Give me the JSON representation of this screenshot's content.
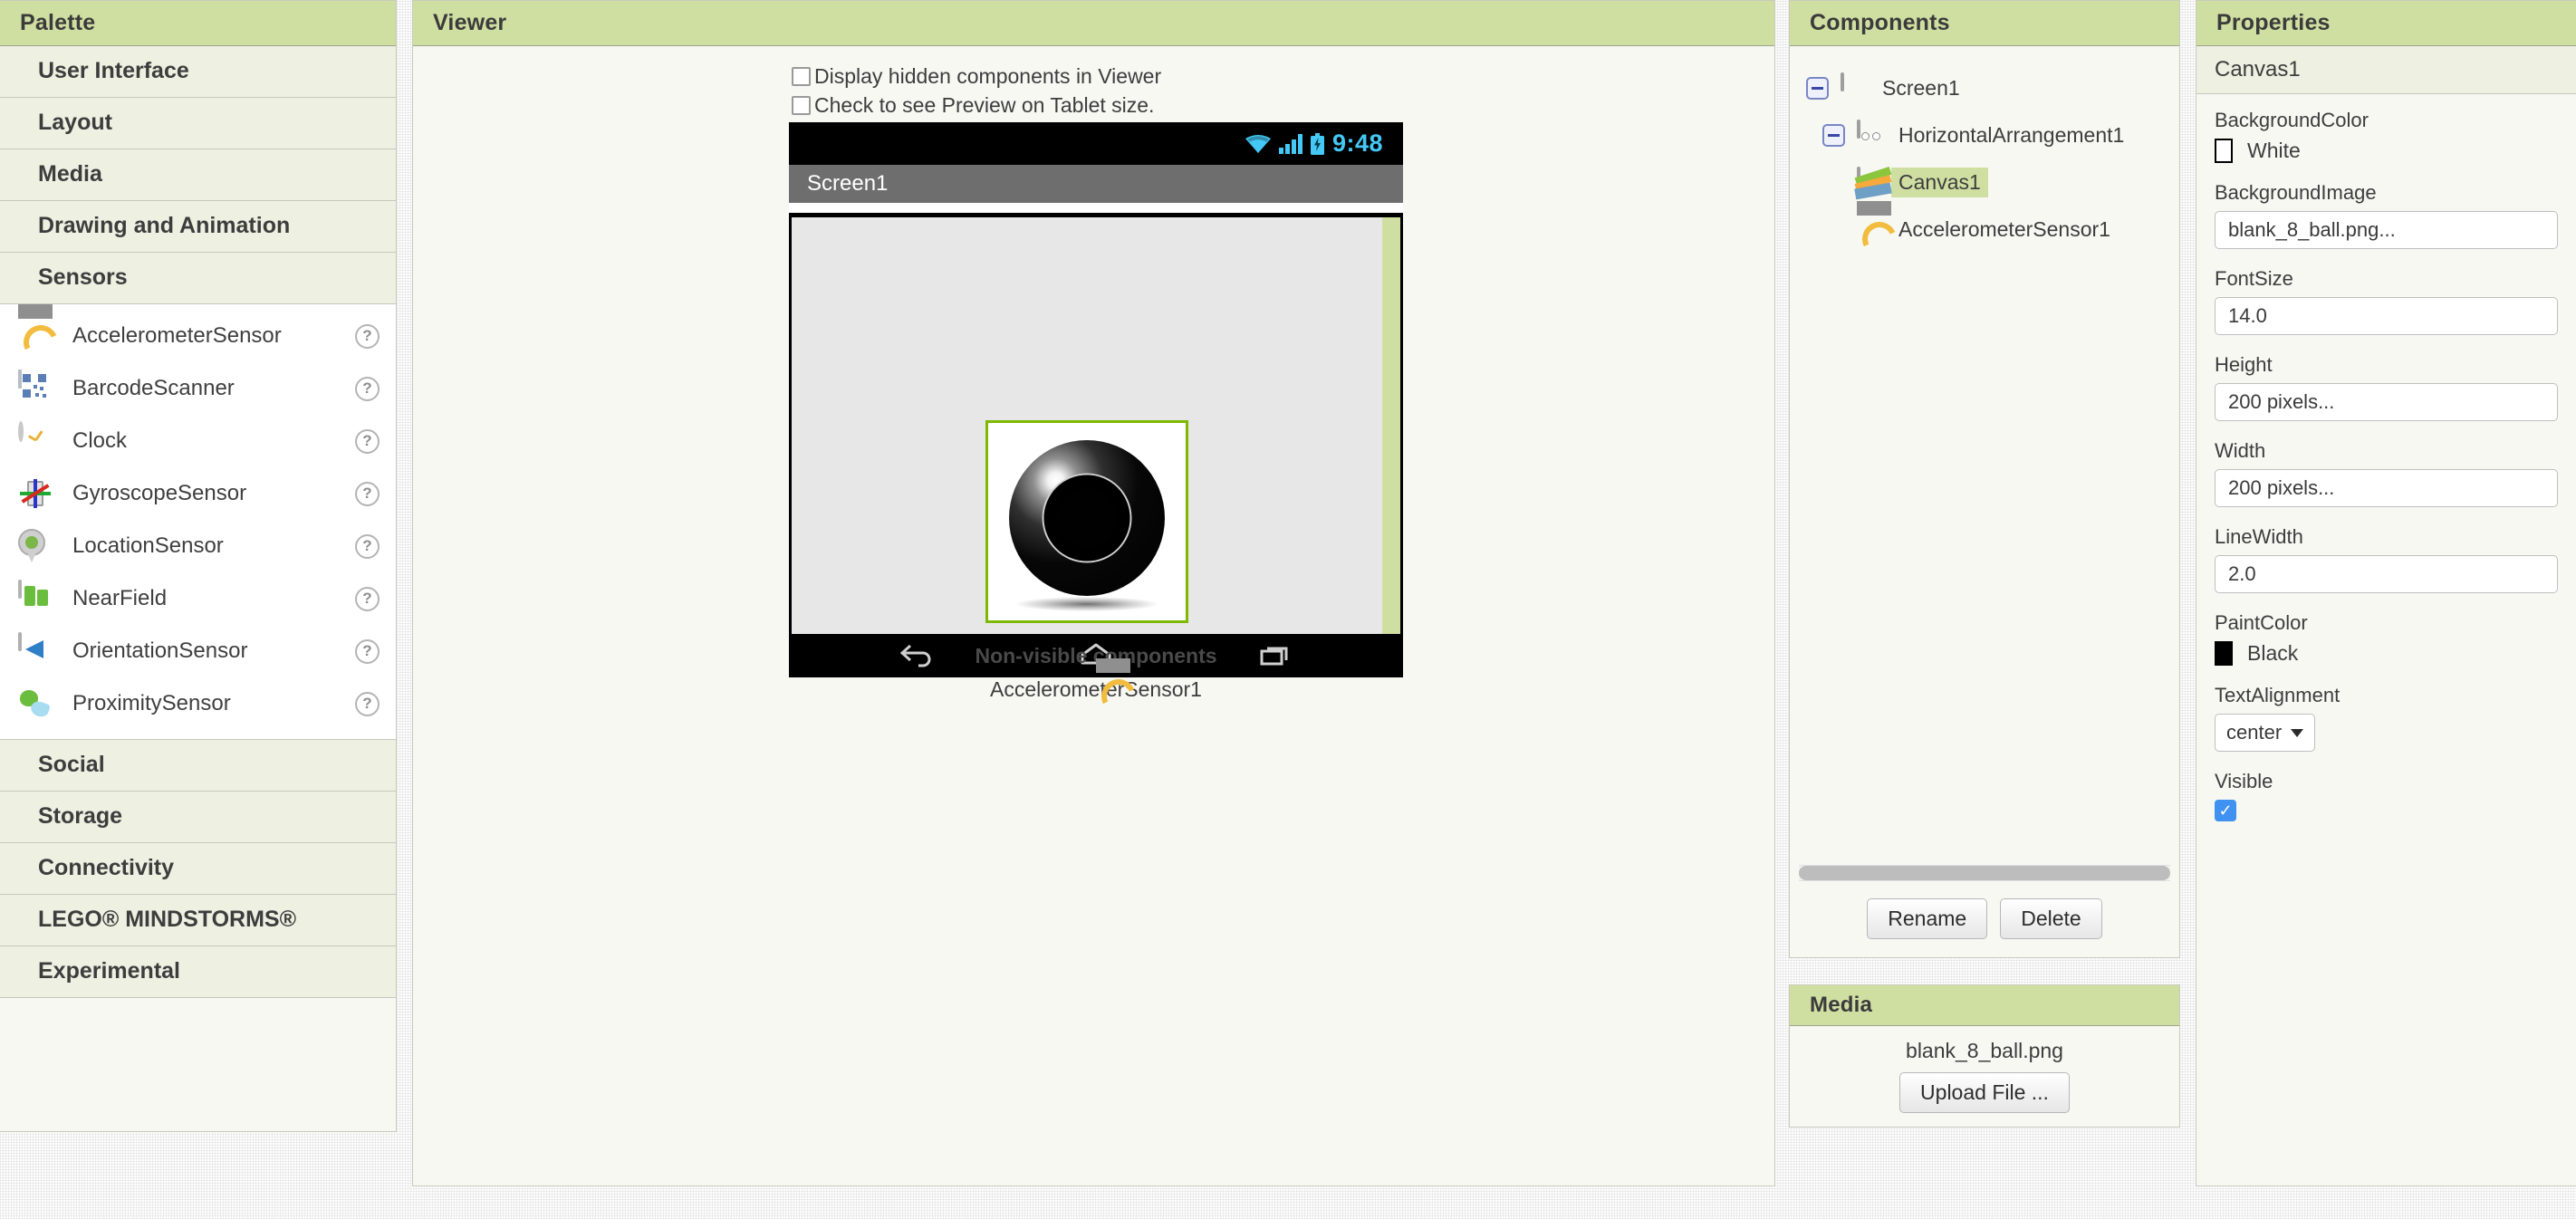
{
  "palette": {
    "title": "Palette",
    "sections": [
      {
        "label": "User Interface"
      },
      {
        "label": "Layout"
      },
      {
        "label": "Media"
      },
      {
        "label": "Drawing and Animation"
      },
      {
        "label": "Sensors"
      }
    ],
    "sensors_items": [
      {
        "label": "AccelerometerSensor",
        "icon": "accelerometer-icon",
        "help": "?"
      },
      {
        "label": "BarcodeScanner",
        "icon": "barcode-icon",
        "help": "?"
      },
      {
        "label": "Clock",
        "icon": "clock-icon",
        "help": "?"
      },
      {
        "label": "GyroscopeSensor",
        "icon": "gyroscope-icon",
        "help": "?"
      },
      {
        "label": "LocationSensor",
        "icon": "location-pin-icon",
        "help": "?"
      },
      {
        "label": "NearField",
        "icon": "nfc-icon",
        "help": "?"
      },
      {
        "label": "OrientationSensor",
        "icon": "orientation-icon",
        "help": "?"
      },
      {
        "label": "ProximitySensor",
        "icon": "proximity-icon",
        "help": "?"
      }
    ],
    "sections_bottom": [
      {
        "label": "Social"
      },
      {
        "label": "Storage"
      },
      {
        "label": "Connectivity"
      },
      {
        "label": "LEGO® MINDSTORMS®"
      },
      {
        "label": "Experimental"
      }
    ]
  },
  "viewer": {
    "title": "Viewer",
    "checkbox_hidden": "Display hidden components in Viewer",
    "checkbox_tablet": "Check to see Preview on Tablet size.",
    "phone": {
      "status_time": "9:48",
      "title": "Screen1",
      "nav_back_icon": "back-arrow-icon",
      "nav_home_icon": "home-icon",
      "nav_recents_icon": "recents-icon"
    },
    "nonvisible_title": "Non-visible components",
    "nonvisible_items": [
      {
        "label": "AccelerometerSensor1",
        "icon": "accelerometer-icon"
      }
    ]
  },
  "components": {
    "title": "Components",
    "tree": [
      {
        "label": "Screen1",
        "icon": "screen-icon",
        "indent": 0,
        "toggle": true,
        "selected": false
      },
      {
        "label": "HorizontalArrangement1",
        "icon": "horizontal-arrangement-icon",
        "indent": 1,
        "toggle": true,
        "selected": false
      },
      {
        "label": "Canvas1",
        "icon": "canvas-icon",
        "indent": 2,
        "toggle": false,
        "selected": true
      },
      {
        "label": "AccelerometerSensor1",
        "icon": "accelerometer-icon",
        "indent": 2,
        "toggle": false,
        "selected": false
      }
    ],
    "rename_label": "Rename",
    "delete_label": "Delete"
  },
  "media": {
    "title": "Media",
    "files": [
      "blank_8_ball.png"
    ],
    "upload_label": "Upload File ..."
  },
  "properties": {
    "title": "Properties",
    "component_name": "Canvas1",
    "items": [
      {
        "name": "BackgroundColor",
        "kind": "color",
        "value": "White",
        "swatch": "#ffffff"
      },
      {
        "name": "BackgroundImage",
        "kind": "text",
        "value": "blank_8_ball.png..."
      },
      {
        "name": "FontSize",
        "kind": "text",
        "value": "14.0"
      },
      {
        "name": "Height",
        "kind": "text",
        "value": "200 pixels..."
      },
      {
        "name": "Width",
        "kind": "text",
        "value": "200 pixels..."
      },
      {
        "name": "LineWidth",
        "kind": "text",
        "value": "2.0"
      },
      {
        "name": "PaintColor",
        "kind": "color",
        "value": "Black",
        "swatch": "#000000"
      },
      {
        "name": "TextAlignment",
        "kind": "select",
        "value": "center"
      },
      {
        "name": "Visible",
        "kind": "checkbox",
        "value": "✓"
      }
    ]
  },
  "colors": {
    "panel_header": "#cfdfa2",
    "panel_bg": "#f7f8f2",
    "section_bg": "#eef0e2",
    "canvas_border": "#7fb800",
    "status_accent": "#44c8f5",
    "selected_highlight": "#cfdfa2"
  }
}
